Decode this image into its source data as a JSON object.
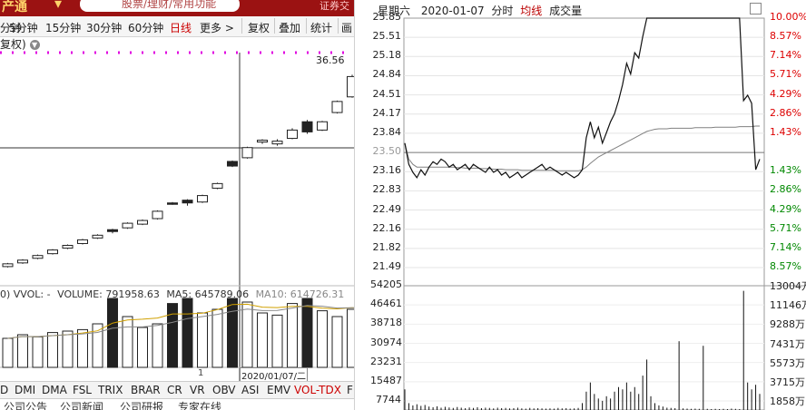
{
  "left_panel": {
    "brand": "产通",
    "search_placeholder": "股票/理财/常用功能",
    "account_label": "证券交",
    "period_tabs": [
      "分钟",
      "5分钟",
      "15分钟",
      "30分钟",
      "60分钟",
      "日线",
      "更多 >"
    ],
    "active_period": "日线",
    "tools": [
      "复权",
      "叠加",
      "统计",
      "画"
    ],
    "adjust_label": "复权)",
    "high_marker": "36.56",
    "volume_stats": {
      "prefix": "0) VVOL: -",
      "volume": "VOLUME: 791958.63",
      "ma5": "MA5: 645789.06",
      "ma10": "MA10: 614726.31"
    },
    "timeline_marker": "1",
    "cursor_date": "2020/01/07/二",
    "indicators": [
      "D",
      "DMI",
      "DMA",
      "FSL",
      "TRIX",
      "BRAR",
      "CR",
      "VR",
      "OBV",
      "ASI",
      "EMV",
      "VOL-TDX",
      "F"
    ],
    "active_indicator": "VOL-TDX",
    "news_tabs": [
      "公司公告",
      "公司新闻",
      "公司研报",
      "专家在线"
    ]
  },
  "right_panel": {
    "header": {
      "day": "星期六",
      "date": "2020-01-07",
      "mode": "分时",
      "avg": "均线",
      "volume": "成交量"
    },
    "price_labels": [
      "25.85",
      "25.51",
      "25.18",
      "24.84",
      "24.51",
      "24.17",
      "23.84",
      "23.50",
      "23.16",
      "22.83",
      "22.49",
      "22.16",
      "21.82",
      "21.49"
    ],
    "pct_labels": [
      "10.00%",
      "8.57%",
      "7.14%",
      "5.71%",
      "4.29%",
      "2.86%",
      "1.43%",
      "",
      "1.43%",
      "2.86%",
      "4.29%",
      "5.71%",
      "7.14%",
      "8.57%"
    ],
    "vol_labels_left": [
      "54205",
      "46461",
      "38718",
      "30974",
      "23231",
      "15487",
      "7744"
    ],
    "vol_labels_right": [
      "13004万",
      "11146万",
      "9288万",
      "7431万",
      "5573万",
      "3715万",
      "1858万"
    ]
  },
  "colors": {
    "up": "#d00000",
    "down": "#008000",
    "neutral": "#999999",
    "brand_bar": "#9b1212",
    "magenta_line": "#e000e0",
    "avg_line": "#808080"
  },
  "chart_data": [
    {
      "type": "candlestick",
      "title": "日线",
      "candles": [
        {
          "open": 21.1,
          "close": 21.25,
          "high": 21.3,
          "low": 21.05
        },
        {
          "open": 21.3,
          "close": 21.45,
          "high": 21.5,
          "low": 21.25
        },
        {
          "open": 21.55,
          "close": 21.7,
          "high": 21.75,
          "low": 21.5
        },
        {
          "open": 21.8,
          "close": 22.0,
          "high": 22.05,
          "low": 21.75
        },
        {
          "open": 22.1,
          "close": 22.25,
          "high": 22.3,
          "low": 22.05
        },
        {
          "open": 22.35,
          "close": 22.55,
          "high": 22.6,
          "low": 22.3
        },
        {
          "open": 22.65,
          "close": 22.8,
          "high": 22.85,
          "low": 22.6
        },
        {
          "open": 23.1,
          "close": 23.0,
          "high": 23.15,
          "low": 22.9
        },
        {
          "open": 23.2,
          "close": 23.45,
          "high": 23.5,
          "low": 23.15
        },
        {
          "open": 23.4,
          "close": 23.6,
          "high": 23.65,
          "low": 23.35
        },
        {
          "open": 23.7,
          "close": 24.1,
          "high": 24.15,
          "low": 23.65
        },
        {
          "open": 24.55,
          "close": 24.5,
          "high": 24.6,
          "low": 24.45
        },
        {
          "open": 24.7,
          "close": 24.55,
          "high": 24.75,
          "low": 24.4
        },
        {
          "open": 24.6,
          "close": 24.95,
          "high": 25.0,
          "low": 24.55
        },
        {
          "open": 25.35,
          "close": 25.6,
          "high": 25.65,
          "low": 25.3
        },
        {
          "open": 26.8,
          "close": 26.55,
          "high": 26.85,
          "low": 26.5
        },
        {
          "open": 27.0,
          "close": 27.55,
          "high": 27.6,
          "low": 26.95
        },
        {
          "open": 27.85,
          "close": 27.95,
          "high": 28.0,
          "low": 27.75
        },
        {
          "open": 27.75,
          "close": 27.9,
          "high": 28.0,
          "low": 27.65
        },
        {
          "open": 28.05,
          "close": 28.5,
          "high": 28.6,
          "low": 28.0
        },
        {
          "open": 28.95,
          "close": 28.4,
          "high": 29.05,
          "low": 28.3
        },
        {
          "open": 28.5,
          "close": 28.95,
          "high": 29.0,
          "low": 28.45
        },
        {
          "open": 29.45,
          "close": 30.05,
          "high": 30.1,
          "low": 29.4
        },
        {
          "open": 30.3,
          "close": 31.4,
          "high": 31.5,
          "low": 30.25
        },
        {
          "open": 31.4,
          "close": 32.35,
          "high": 32.4,
          "low": 31.35
        }
      ],
      "volumes": [
        40,
        45,
        42,
        48,
        50,
        52,
        60,
        95,
        70,
        55,
        60,
        88,
        95,
        75,
        80,
        95,
        90,
        75,
        72,
        88,
        95,
        78,
        70,
        80,
        80
      ]
    },
    {
      "type": "line",
      "title": "分时",
      "ylim": [
        21.16,
        25.85
      ],
      "prev_close": 23.5,
      "price": [
        23.5,
        23.1,
        22.95,
        22.85,
        23.0,
        22.9,
        23.05,
        23.15,
        23.1,
        23.2,
        23.15,
        23.05,
        23.1,
        23.0,
        23.05,
        23.1,
        23.0,
        23.1,
        23.05,
        23.0,
        22.95,
        23.05,
        22.95,
        23.0,
        22.9,
        22.95,
        22.85,
        22.9,
        22.95,
        22.85,
        22.9,
        22.95,
        23.0,
        23.05,
        23.1,
        23.0,
        23.05,
        23.0,
        22.95,
        22.9,
        22.95,
        22.9,
        22.85,
        22.9,
        23.0,
        23.6,
        23.9,
        23.6,
        23.8,
        23.5,
        23.7,
        23.9,
        24.05,
        24.3,
        24.6,
        25.0,
        24.8,
        25.2,
        25.1,
        25.5,
        25.85,
        25.85,
        25.85,
        25.85,
        25.85,
        25.85,
        25.85,
        25.85,
        25.85,
        25.85,
        25.85,
        25.85,
        25.85,
        25.85,
        25.85,
        25.85,
        25.85,
        25.85,
        25.85,
        25.85,
        25.85,
        25.85,
        25.85,
        25.85,
        24.3,
        24.4,
        24.25,
        23.0,
        23.2
      ],
      "avg": [
        23.5,
        23.2,
        23.1,
        23.05,
        23.05,
        23.05,
        23.05,
        23.05,
        23.05,
        23.05,
        23.05,
        23.05,
        23.05,
        23.04,
        23.04,
        23.03,
        23.03,
        23.03,
        23.03,
        23.02,
        23.02,
        23.02,
        23.01,
        23.01,
        23.01,
        23.0,
        23.0,
        23.0,
        23.0,
        22.99,
        22.99,
        22.99,
        22.99,
        22.99,
        22.99,
        22.99,
        22.99,
        22.99,
        22.98,
        22.98,
        22.98,
        22.98,
        22.98,
        22.98,
        23.0,
        23.05,
        23.12,
        23.18,
        23.24,
        23.28,
        23.32,
        23.36,
        23.4,
        23.44,
        23.48,
        23.52,
        23.56,
        23.6,
        23.64,
        23.68,
        23.72,
        23.74,
        23.76,
        23.77,
        23.77,
        23.77,
        23.78,
        23.78,
        23.78,
        23.78,
        23.78,
        23.78,
        23.79,
        23.79,
        23.79,
        23.79,
        23.79,
        23.8,
        23.8,
        23.8,
        23.8,
        23.8,
        23.8,
        23.81,
        23.81,
        23.81,
        23.81,
        23.82,
        23.82
      ],
      "volume": [
        9000,
        3000,
        2000,
        2500,
        1800,
        2200,
        1500,
        1200,
        1600,
        1000,
        1400,
        1100,
        900,
        1300,
        1000,
        800,
        1100,
        900,
        1200,
        800,
        1000,
        900,
        700,
        1000,
        800,
        900,
        700,
        800,
        1000,
        700,
        600,
        900,
        700,
        800,
        700,
        600,
        700,
        600,
        900,
        700,
        800,
        600,
        700,
        900,
        3000,
        8000,
        12000,
        7000,
        5000,
        4000,
        6000,
        5000,
        8000,
        10000,
        9000,
        12000,
        8000,
        10000,
        7000,
        15000,
        22000,
        6000,
        3000,
        2000,
        1500,
        1000,
        900,
        800,
        30000,
        700,
        600,
        500,
        600,
        500,
        28000,
        500,
        400,
        500,
        400,
        500,
        400,
        600,
        500,
        400,
        52000,
        12000,
        9000,
        11000,
        7000
      ]
    }
  ]
}
